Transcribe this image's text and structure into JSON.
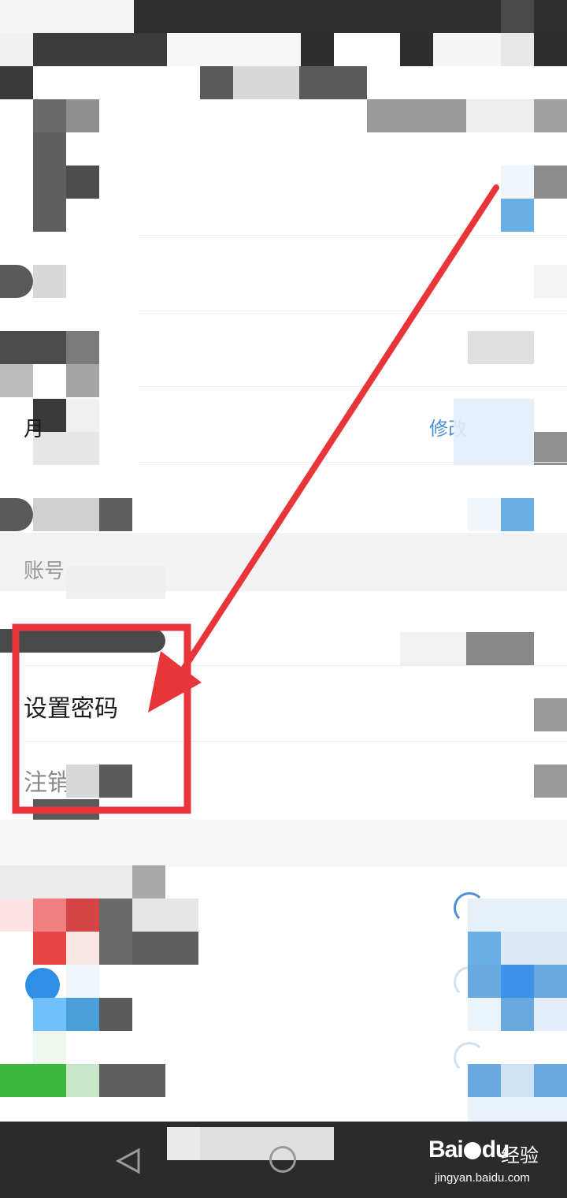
{
  "settings": {
    "row_username": {
      "label_fragment": "月",
      "action": "修改"
    },
    "row_account": {
      "label": "账号"
    },
    "row_set_password": {
      "label": "设置密码"
    },
    "row_logout": {
      "label": "注销"
    }
  },
  "watermark": {
    "brand": "Bai",
    "brand_suffix": "du",
    "jingyan": "经验",
    "url": "jingyan.baidu.com"
  },
  "annotation": {
    "arrow_color": "#e8353a",
    "box_color": "#e8353a"
  },
  "icons": {
    "nav_back": "triangle-back-icon",
    "nav_home": "circle-home-icon",
    "paw": "baidu-paw-icon"
  }
}
